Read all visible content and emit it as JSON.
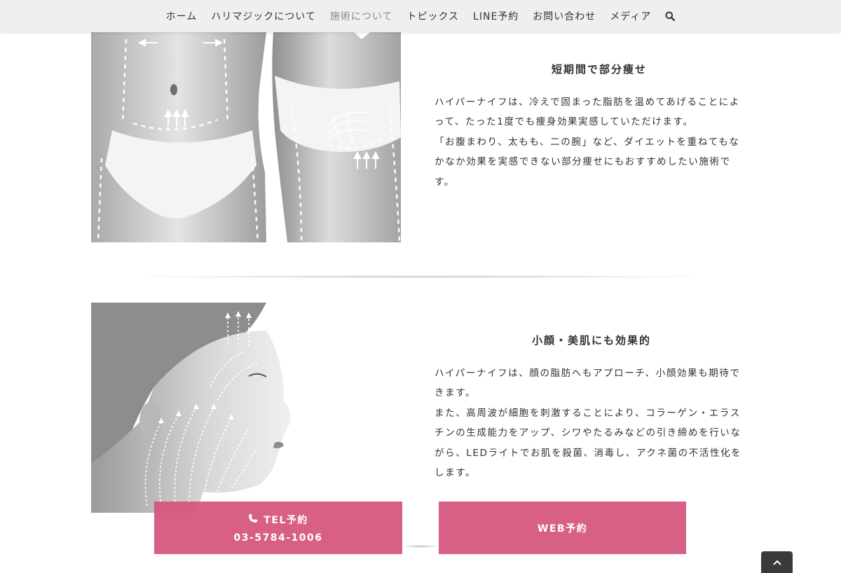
{
  "nav": {
    "items": [
      {
        "label": "ホーム",
        "active": false
      },
      {
        "label": "ハリマジックについて",
        "active": false
      },
      {
        "label": "施術について",
        "active": true
      },
      {
        "label": "トピックス",
        "active": false
      },
      {
        "label": "LINE予約",
        "active": false
      },
      {
        "label": "お問い合わせ",
        "active": false
      },
      {
        "label": "メディア",
        "active": false
      }
    ],
    "search_icon": "search-icon"
  },
  "sections": [
    {
      "title": "短期間で部分痩せ",
      "lines": [
        "ハイパーナイフは、冷えで固まった脂肪を温めてあげることによ",
        "って、たった1度でも痩身効果実感していただけます。",
        "「お腹まわり、太もも、二の腕」など、ダイエットを重ねてもな",
        "かなか効果を実感できない部分痩せにもおすすめしたい施術で",
        "す。"
      ]
    },
    {
      "title": "小顔・美肌にも効果的",
      "lines": [
        "ハイパーナイフは、顔の脂肪へもアプローチ、小顔効果も期待で",
        "きます。",
        "また、高周波が細胞を刺激することにより、コラーゲン・エラス",
        "チンの生成能力をアップ、シワやたるみなどの引き締めを行いな",
        "がら、LEDライトでお肌を殺菌、消毒し、アクネ菌の不活性化を",
        "します。"
      ]
    }
  ],
  "cta": {
    "tel_label": "TEL予約",
    "tel_number": "03-5784-1006",
    "web_label": "WEB予約",
    "color": "#d5547c"
  },
  "scroll_top_icon": "chevron-up-icon"
}
